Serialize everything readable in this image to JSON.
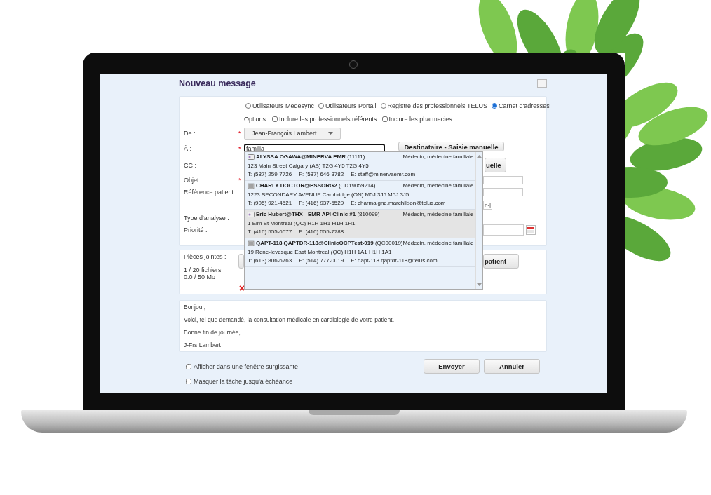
{
  "dialog": {
    "title": "Nouveau message"
  },
  "sources": [
    {
      "label": "Utilisateurs Medesync",
      "selected": false
    },
    {
      "label": "Utilisateurs Portail",
      "selected": false
    },
    {
      "label": "Registre des professionnels TELUS",
      "selected": false
    },
    {
      "label": "Carnet d'adresses",
      "selected": true
    }
  ],
  "options": {
    "label": "Options :",
    "items": [
      {
        "label": "Inclure les professionnels référents",
        "checked": false
      },
      {
        "label": "Inclure les pharmacies",
        "checked": false
      }
    ]
  },
  "from": {
    "label": "De :",
    "marker": "*",
    "value": "Jean-François Lambert"
  },
  "to": {
    "label": "À :",
    "marker": "*",
    "value": "familia",
    "button": "Destinataire - Saisie manuelle"
  },
  "cc": {
    "label": "CC :",
    "button": "uelle"
  },
  "subject": {
    "label": "Objet :",
    "marker": "*"
  },
  "patient_ref": {
    "label": "Référence patient :"
  },
  "cut_control": {
    "text": "n-|"
  },
  "analysis_type": {
    "label": "Type d'analyse :"
  },
  "priority": {
    "label": "Priorité :"
  },
  "suggestions": [
    {
      "kind": "card",
      "name": "ALYSSA OGAWA@MINERVA EMR",
      "code": "(11111)",
      "specialty": "Médecin, médecine familiale",
      "address": "123 Main Street Calgary (AB) T2G 4Y5 T2G 4Y5",
      "phone": "T: (587) 259-7726",
      "fax": "F: (587) 646-3782",
      "email": "E: staff@minervaemr.com",
      "selected": false
    },
    {
      "kind": "building",
      "name": "CHARLY DOCTOR@PSSORG2",
      "code": "(CD19059214)",
      "specialty": "Médecin, médecine familiale",
      "address": "1223 SECONDARY AVENUE Cambridge (ON) M5J 3J5 M5J 3J5",
      "phone": "T: (905) 921-4521",
      "fax": "F: (416) 937-5529",
      "email": "E: charmaigne.marchildon@telus.com",
      "selected": false
    },
    {
      "kind": "card",
      "name": "Eric Hubert@THX - EMR API Clinic #1",
      "code": "(810099)",
      "specialty": "Médecin, médecine familiale",
      "address": "1 Elm St Montreal (QC) H1H 1H1 H1H 1H1",
      "phone": "T: (416) 555-6677",
      "fax": "F: (416) 555-7788",
      "selected": true
    },
    {
      "kind": "building",
      "name": "QAPT-118 QAPTDR-118@ClinicOCPTest-019",
      "code": "(QC00019)",
      "specialty": "Médecin, médecine familiale",
      "address": "19 Rene-levesque East Montreal (QC) H1H 1A1 H1H 1A1",
      "phone": "T: (613) 806-6763",
      "fax": "F: (514) 777-0019",
      "email": "E: qapt-118.qaptdr-118@telus.com",
      "selected": false
    }
  ],
  "attachments": {
    "label": "Pièces jointes :",
    "count": "1 / 20 fichiers",
    "size": "0.0 / 50 Mo",
    "button": "patient"
  },
  "message": [
    "Bonjour,",
    "Voici, tel que demandé, la consultation médicale en cardiologie de votre patient.",
    "Bonne fin de journée,",
    "J-Frs Lambert"
  ],
  "footer_options": [
    {
      "label": "Afficher dans une fenêtre surgissante",
      "checked": false
    },
    {
      "label": "Masquer la tâche jusqu'à échéance",
      "checked": false
    }
  ],
  "buttons": [
    "Envoyer",
    "Annuler"
  ]
}
